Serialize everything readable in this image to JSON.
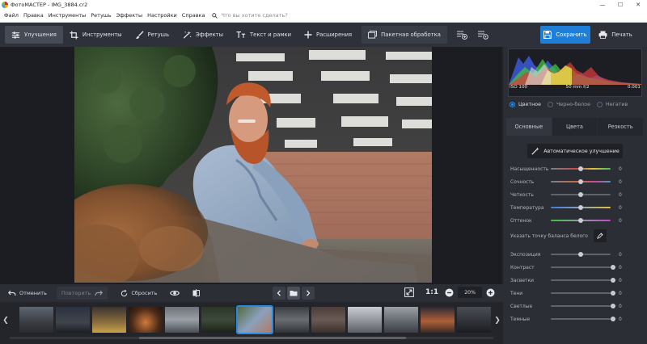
{
  "window": {
    "title": "ФотоМАСТЕР - IMG_3884.cr2"
  },
  "menu": {
    "items": [
      "Файл",
      "Правка",
      "Инструменты",
      "Ретушь",
      "Эффекты",
      "Настройки",
      "Справка"
    ],
    "search_placeholder": "Что вы хотите сделать?"
  },
  "toolbar": {
    "tabs": [
      "Улучшения",
      "Инструменты",
      "Ретушь",
      "Эффекты",
      "Текст и рамки",
      "Расширения"
    ],
    "batch_label": "Пакетная обработка",
    "save_label": "Сохранить",
    "print_label": "Печать"
  },
  "histogram": {
    "iso": "ISO 100",
    "lens": "50 mm f/2",
    "shutter": "0.001"
  },
  "color_modes": [
    "Цветное",
    "Черно-белое",
    "Негатив"
  ],
  "panel_tabs": [
    "Основные",
    "Цвета",
    "Резкость"
  ],
  "auto_button": "Автоматическое улучшение",
  "sliders_top": [
    {
      "label": "Насыщенность",
      "value": "0"
    },
    {
      "label": "Сочность",
      "value": "0"
    },
    {
      "label": "Четкость",
      "value": "0"
    },
    {
      "label": "Температура",
      "value": "0"
    },
    {
      "label": "Оттенок",
      "value": "0"
    }
  ],
  "white_balance_label": "Указать точку баланса белого",
  "sliders_bottom": [
    {
      "label": "Экспозиция",
      "value": "0"
    },
    {
      "label": "Контраст",
      "value": "0"
    },
    {
      "label": "Засветки",
      "value": "0"
    },
    {
      "label": "Тени",
      "value": "0"
    },
    {
      "label": "Светлые",
      "value": "0"
    },
    {
      "label": "Темные",
      "value": "0"
    }
  ],
  "bottombar": {
    "undo_label": "Отменить",
    "redo_label": "Повторить",
    "reset_label": "Сбросить",
    "fit_label": "1:1",
    "zoom_value": "20%"
  },
  "icons": {
    "search": "search-icon",
    "enhance": "sliders-icon",
    "crop": "crop-icon",
    "brush": "brush-icon",
    "effects": "magic-wand-icon",
    "text": "text-icon",
    "plus": "plus-icon",
    "batch": "batch-icon",
    "save": "floppy-icon",
    "print": "printer-icon",
    "eye": "eye-icon",
    "compare": "compare-icon",
    "folder": "folder-icon",
    "eyedropper": "eyedropper-icon"
  },
  "colors": {
    "accent": "#1f7fd8",
    "panel": "#2b2e35",
    "toolbar": "#2e3139"
  }
}
